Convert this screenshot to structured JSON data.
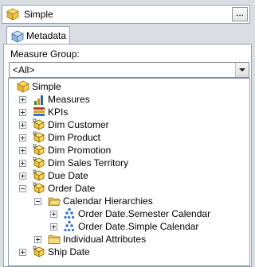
{
  "cube": {
    "name": "Simple",
    "browse_label": "..."
  },
  "tabs": [
    {
      "label": "Metadata"
    }
  ],
  "measure_group": {
    "label": "Measure Group:",
    "value": "<All>"
  },
  "tree": {
    "root": {
      "label": "Simple"
    },
    "nodes": [
      {
        "label": "Measures",
        "icon": "measures-icon"
      },
      {
        "label": "KPIs",
        "icon": "kpi-icon"
      },
      {
        "label": "Dim Customer",
        "icon": "dimension-icon"
      },
      {
        "label": "Dim Product",
        "icon": "dimension-icon"
      },
      {
        "label": "Dim Promotion",
        "icon": "dimension-icon"
      },
      {
        "label": "Dim Sales Territory",
        "icon": "dimension-icon"
      },
      {
        "label": "Due Date",
        "icon": "dimension-icon"
      },
      {
        "label": "Order Date",
        "icon": "dimension-icon",
        "expanded": true
      },
      {
        "label": "Calendar Hierarchies",
        "icon": "folder-icon",
        "expanded": true
      },
      {
        "label": "Order Date.Semester Calendar",
        "icon": "hierarchy-icon"
      },
      {
        "label": "Order Date.Simple Calendar",
        "icon": "hierarchy-icon"
      },
      {
        "label": "Individual Attributes",
        "icon": "folder-icon"
      },
      {
        "label": "Ship Date",
        "icon": "dimension-icon"
      }
    ]
  }
}
